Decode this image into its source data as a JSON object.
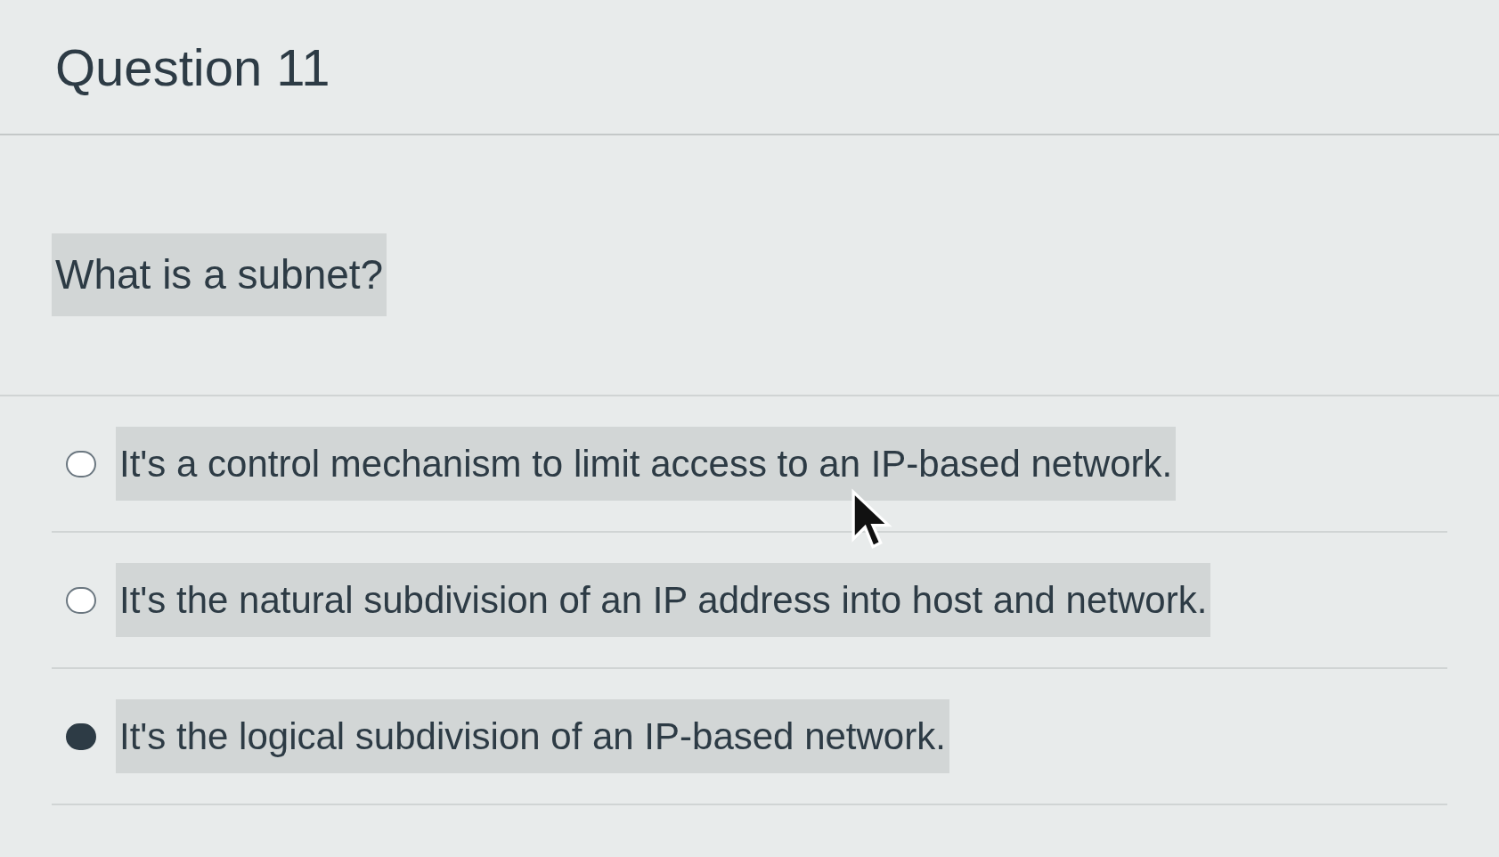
{
  "title": "Question 11",
  "question": "What is a subnet?",
  "options": [
    {
      "label": "It's a control mechanism to limit access to an IP-based network.",
      "selected": false
    },
    {
      "label": "It's the natural subdivision of an IP address into host and network.",
      "selected": false
    },
    {
      "label": "It's the logical subdivision of an IP-based network.",
      "selected": true
    }
  ]
}
